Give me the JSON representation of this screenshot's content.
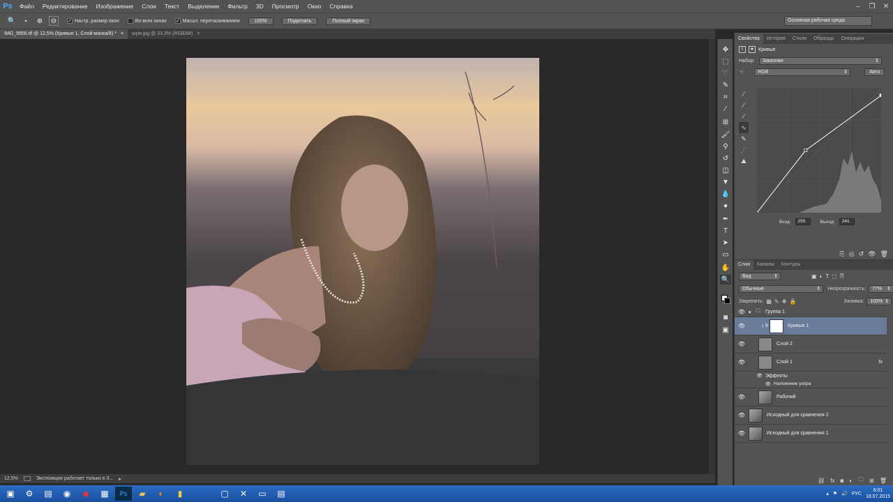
{
  "app": {
    "logo": "Ps"
  },
  "menu": [
    "Файл",
    "Редактирование",
    "Изображение",
    "Слои",
    "Текст",
    "Выделение",
    "Фильтр",
    "3D",
    "Просмотр",
    "Окно",
    "Справка"
  ],
  "options": {
    "check1": "Настр. размер окон",
    "check2": "Во всех окнах",
    "check3": "Масшт. перетаскиванием",
    "btn_100": "100%",
    "btn_fit": "Подогнать",
    "btn_full": "Полный экран",
    "workspace": "Основная рабочая среда"
  },
  "doc_tabs": [
    {
      "label": "IMG_9956.tif @ 12,5% (Кривые 1, Слой-маска/8) *",
      "close": "×"
    },
    {
      "label": "шум.jpg @ 33,3% (RGB/8#)",
      "close": "×"
    }
  ],
  "status": {
    "zoom": "12,5%",
    "message": "Экспозиция работает только в 3...",
    "arrow": "▸"
  },
  "panel_tabs_top": [
    "Свойства",
    "История",
    "Стили",
    "Образцы",
    "Операции"
  ],
  "properties": {
    "title": "Кривые",
    "preset_label": "Набор:",
    "preset_value": "Заказная",
    "channel": "RGB",
    "auto": "Авто",
    "input_label": "Вход:",
    "input_value": "255",
    "output_label": "Выход:",
    "output_value": "241"
  },
  "curve": {
    "points": [
      [
        0,
        0
      ],
      [
        100,
        128
      ],
      [
        255,
        241
      ]
    ],
    "accent": "#ffffff"
  },
  "panel_tabs_layers": [
    "Слои",
    "Каналы",
    "Контуры"
  ],
  "layers_panel": {
    "filter": "Вид",
    "blend": "Обычные",
    "opacity_label": "Непрозрачность:",
    "opacity_value": "77%",
    "lock_label": "Закрепить:",
    "fill_label": "Заливка:",
    "fill_value": "100%"
  },
  "layers": [
    {
      "name": "Группа 1",
      "type": "group"
    },
    {
      "name": "Кривые 1",
      "type": "adjustment",
      "selected": true
    },
    {
      "name": "Слой 2",
      "type": "layer"
    },
    {
      "name": "Слой 1",
      "type": "layer",
      "fx": "fx"
    },
    {
      "name": "Эффекты",
      "type": "effects"
    },
    {
      "name": "Наложение узора",
      "type": "effect"
    },
    {
      "name": "Рабочий",
      "type": "photo"
    },
    {
      "name": "Исходный для сравнения 2",
      "type": "photo"
    },
    {
      "name": "Исходный для сравнения 1",
      "type": "photo"
    }
  ],
  "taskbar": {
    "lang": "РУС",
    "time": "6:01",
    "date": "18.07.2015"
  }
}
